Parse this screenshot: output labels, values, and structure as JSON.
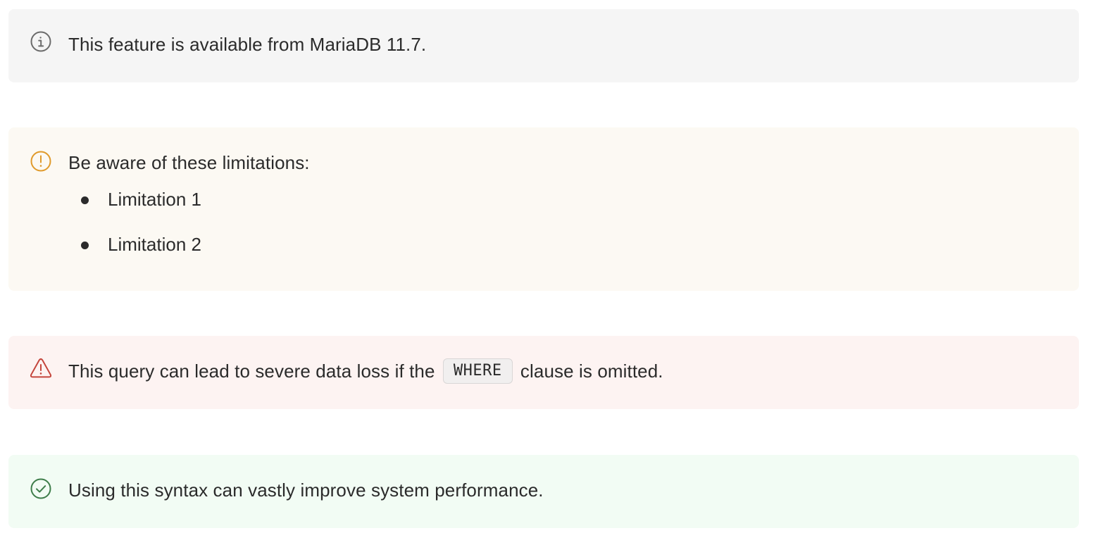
{
  "hints": {
    "info": {
      "icon": "info-circle-icon",
      "color": "#6b6b6b",
      "text": "This feature is available from MariaDB 11.7."
    },
    "warning": {
      "icon": "exclamation-circle-icon",
      "color": "#e09a2b",
      "text": "Be aware of these limitations:",
      "items": [
        "Limitation 1",
        "Limitation 2"
      ]
    },
    "danger": {
      "icon": "warning-triangle-icon",
      "color": "#c4453c",
      "text_before": "This query can lead to severe data loss if the",
      "code": "WHERE",
      "text_after": "clause is omitted."
    },
    "success": {
      "icon": "check-circle-icon",
      "color": "#3e7d4a",
      "text": "Using this syntax can vastly improve system performance."
    }
  }
}
